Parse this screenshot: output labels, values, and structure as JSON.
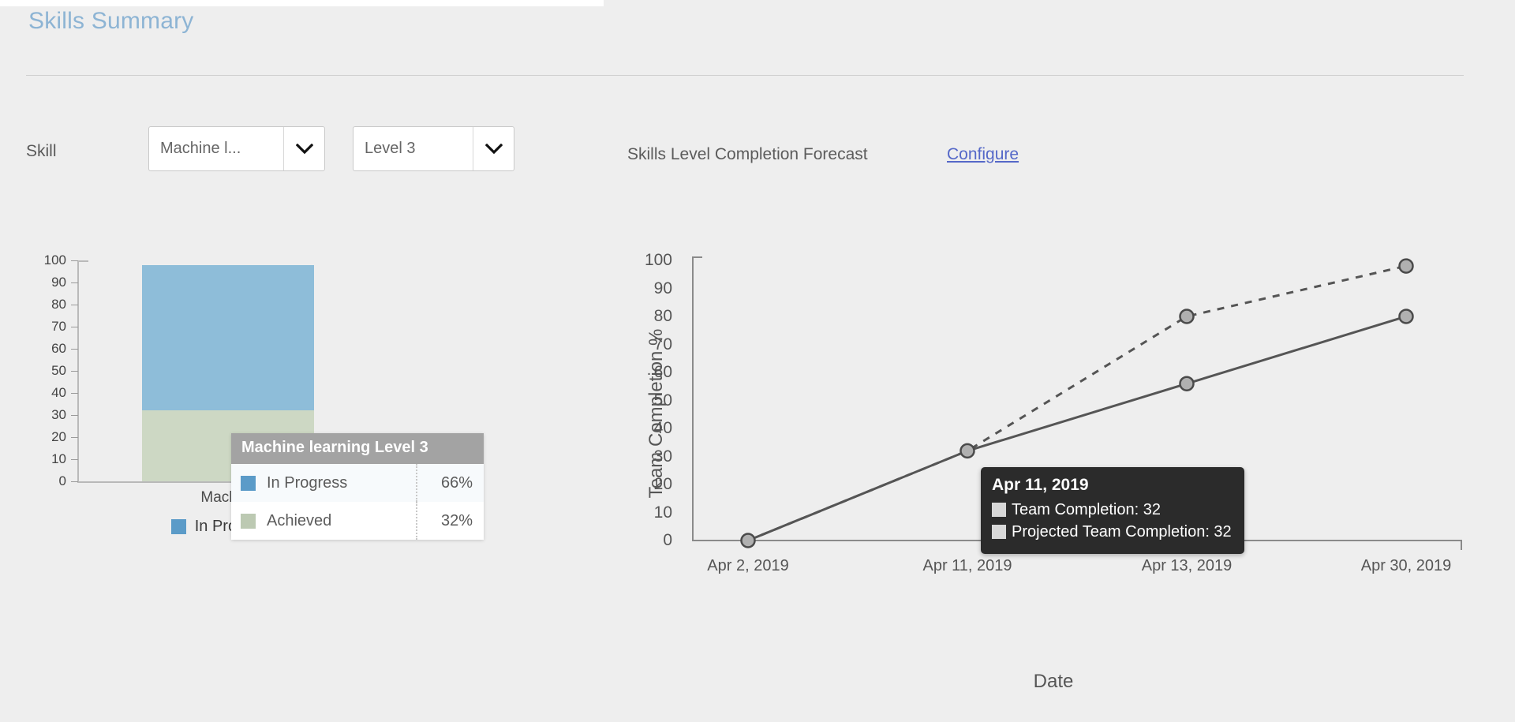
{
  "header": {
    "title": "Skills Summary"
  },
  "controls": {
    "skill_label": "Skill",
    "skill_select": {
      "value": "Machine l...",
      "icon": "chevron-down-icon"
    },
    "level_select": {
      "value": "Level 3",
      "icon": "chevron-down-icon"
    },
    "forecast_title": "Skills Level Completion Forecast",
    "configure_link": "Configure"
  },
  "colors": {
    "title": "#8db4d4",
    "link": "#5568c8",
    "in_progress": "#8ebdd9",
    "achieved": "#cdd8c4",
    "line_actual": "#555555",
    "line_projected": "#555555",
    "tooltip_dark": "#2b2b2b",
    "tooltip_head": "#a3a3a3"
  },
  "bar_tooltip": {
    "title": "Machine learning Level 3",
    "rows": [
      {
        "swatch": "#5b9bc8",
        "label": "In Progress",
        "value": "66%"
      },
      {
        "swatch": "#bcc9b2",
        "label": "Achieved",
        "value": "32%"
      }
    ]
  },
  "line_tooltip": {
    "date": "Apr 11, 2019",
    "rows": [
      {
        "label": "Team Completion: 32"
      },
      {
        "label": "Projected Team Completion: 32"
      }
    ]
  },
  "chart_data": [
    {
      "type": "bar",
      "id": "skills-stacked-bar",
      "title": "",
      "xlabel": "",
      "ylabel": "",
      "categories": [
        "Machine learning Level 3"
      ],
      "ylim": [
        0,
        100
      ],
      "yticks": [
        0,
        10,
        20,
        30,
        40,
        50,
        60,
        70,
        80,
        90,
        100
      ],
      "grid": false,
      "stacked": true,
      "legend_position": "bottom",
      "series": [
        {
          "name": "Achieved",
          "values": [
            32
          ],
          "color": "#cdd8c4"
        },
        {
          "name": "In Progress",
          "values": [
            66
          ],
          "color": "#8ebdd9"
        }
      ],
      "legend": [
        "In Progress",
        "Achieved"
      ]
    },
    {
      "type": "line",
      "id": "skills-level-completion-forecast",
      "title": "Skills Level Completion Forecast",
      "xlabel": "Date",
      "ylabel": "Team Completion %",
      "x": [
        "Apr 2, 2019",
        "Apr 11, 2019",
        "Apr 13, 2019",
        "Apr 30, 2019"
      ],
      "ylim": [
        0,
        100
      ],
      "yticks": [
        0,
        10,
        20,
        30,
        40,
        50,
        60,
        70,
        80,
        90,
        100
      ],
      "grid": false,
      "legend_position": "none",
      "series": [
        {
          "name": "Team Completion",
          "values": [
            0,
            32,
            56,
            80
          ],
          "style": "solid",
          "color": "#555555",
          "marker": "circle"
        },
        {
          "name": "Projected Team Completion",
          "values": [
            0,
            32,
            80,
            98
          ],
          "style": "dashed",
          "color": "#555555",
          "marker": "circle"
        }
      ]
    }
  ]
}
